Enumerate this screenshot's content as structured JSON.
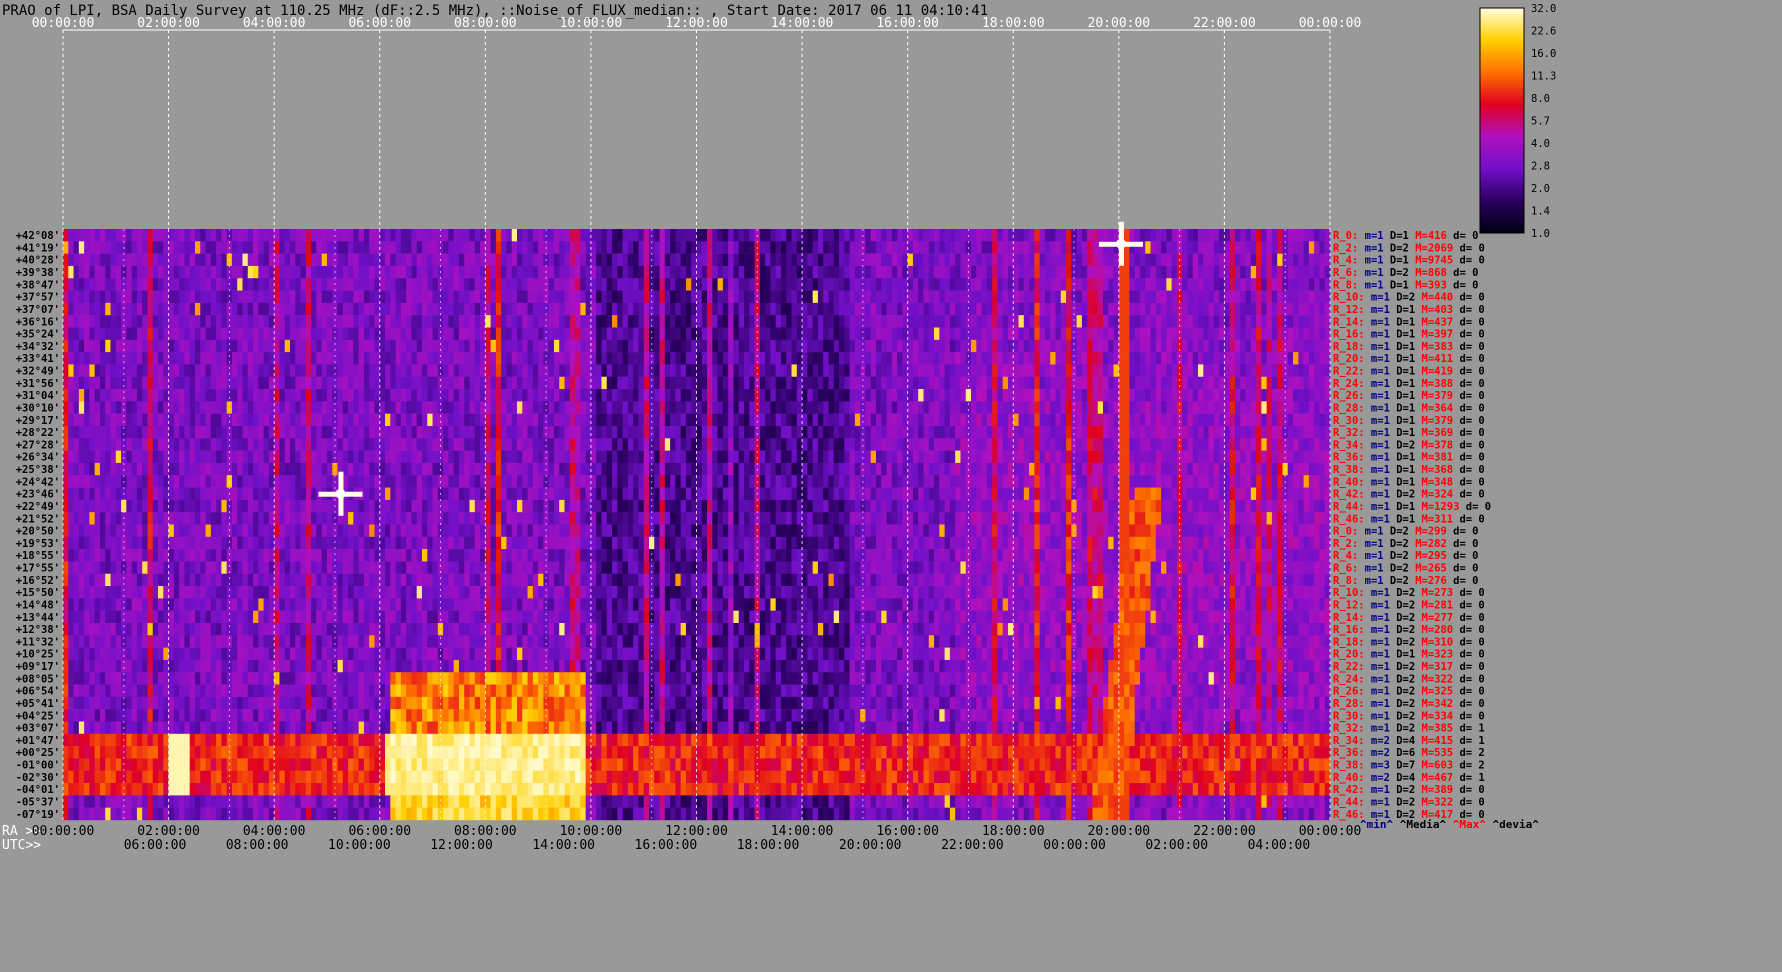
{
  "chart_data": {
    "type": "heatmap",
    "title": "PRAO of LPI, BSA Daily Survey at 110.25 MHz (dF::2.5 MHz), ::Noise_of_FLUX_median:: , Start Date: 2017 06 11 04:10:41",
    "top_time_ticks": [
      "00:00:00",
      "02:00:00",
      "04:00:00",
      "06:00:00",
      "08:00:00",
      "10:00:00",
      "12:00:00",
      "14:00:00",
      "16:00:00",
      "18:00:00",
      "20:00:00",
      "22:00:00",
      "00:00:00"
    ],
    "ra_label": "RA >>",
    "ra_ticks": [
      "00:00:00",
      "02:00:00",
      "04:00:00",
      "06:00:00",
      "08:00:00",
      "10:00:00",
      "12:00:00",
      "14:00:00",
      "16:00:00",
      "18:00:00",
      "20:00:00",
      "22:00:00",
      "00:00:00"
    ],
    "utc_label": "UTC>>",
    "utc_ticks": [
      "06:00:00",
      "08:00:00",
      "10:00:00",
      "12:00:00",
      "14:00:00",
      "16:00:00",
      "18:00:00",
      "20:00:00",
      "22:00:00",
      "00:00:00",
      "02:00:00",
      "04:00:00"
    ],
    "declinations": [
      "+42°08'",
      "+41°19'",
      "+40°28'",
      "+39°38'",
      "+38°47'",
      "+37°57'",
      "+37°07'",
      "+36°16'",
      "+35°24'",
      "+34°32'",
      "+33°41'",
      "+32°49'",
      "+31°56'",
      "+31°04'",
      "+30°10'",
      "+29°17'",
      "+28°22'",
      "+27°28'",
      "+26°34'",
      "+25°38'",
      "+24°42'",
      "+23°46'",
      "+22°49'",
      "+21°52'",
      "+20°50'",
      "+19°53'",
      "+18°55'",
      "+17°55'",
      "+16°52'",
      "+15°50'",
      "+14°48'",
      "+13°44'",
      "+12°38'",
      "+11°32'",
      "+10°25'",
      "+09°17'",
      "+08°05'",
      "+06°54'",
      "+05°41'",
      "+04°25'",
      "+03°07'",
      "+01°47'",
      "+00°25'",
      "-01°00'",
      "-02°30'",
      "-04°01'",
      "-05°37'",
      "-07°19'"
    ],
    "row_stats": [
      {
        "r": "R_0:",
        "m": "m=1",
        "d": "D=1",
        "M": "M=416",
        "dv": "d= 0"
      },
      {
        "r": "R_2:",
        "m": "m=1",
        "d": "D=2",
        "M": "M=2069",
        "dv": "d= 0"
      },
      {
        "r": "R_4:",
        "m": "m=1",
        "d": "D=1",
        "M": "M=9745",
        "dv": "d= 0"
      },
      {
        "r": "R_6:",
        "m": "m=1",
        "d": "D=2",
        "M": "M=868",
        "dv": "d= 0"
      },
      {
        "r": "R_8:",
        "m": "m=1",
        "d": "D=1",
        "M": "M=393",
        "dv": "d= 0"
      },
      {
        "r": "R_10:",
        "m": "m=1",
        "d": "D=2",
        "M": "M=440",
        "dv": "d= 0"
      },
      {
        "r": "R_12:",
        "m": "m=1",
        "d": "D=1",
        "M": "M=403",
        "dv": "d= 0"
      },
      {
        "r": "R_14:",
        "m": "m=1",
        "d": "D=1",
        "M": "M=437",
        "dv": "d= 0"
      },
      {
        "r": "R_16:",
        "m": "m=1",
        "d": "D=1",
        "M": "M=397",
        "dv": "d= 0"
      },
      {
        "r": "R_18:",
        "m": "m=1",
        "d": "D=1",
        "M": "M=383",
        "dv": "d= 0"
      },
      {
        "r": "R_20:",
        "m": "m=1",
        "d": "D=1",
        "M": "M=411",
        "dv": "d= 0"
      },
      {
        "r": "R_22:",
        "m": "m=1",
        "d": "D=1",
        "M": "M=419",
        "dv": "d= 0"
      },
      {
        "r": "R_24:",
        "m": "m=1",
        "d": "D=1",
        "M": "M=388",
        "dv": "d= 0"
      },
      {
        "r": "R_26:",
        "m": "m=1",
        "d": "D=1",
        "M": "M=379",
        "dv": "d= 0"
      },
      {
        "r": "R_28:",
        "m": "m=1",
        "d": "D=1",
        "M": "M=364",
        "dv": "d= 0"
      },
      {
        "r": "R_30:",
        "m": "m=1",
        "d": "D=1",
        "M": "M=379",
        "dv": "d= 0"
      },
      {
        "r": "R_32:",
        "m": "m=1",
        "d": "D=1",
        "M": "M=369",
        "dv": "d= 0"
      },
      {
        "r": "R_34:",
        "m": "m=1",
        "d": "D=2",
        "M": "M=378",
        "dv": "d= 0"
      },
      {
        "r": "R_36:",
        "m": "m=1",
        "d": "D=1",
        "M": "M=381",
        "dv": "d= 0"
      },
      {
        "r": "R_38:",
        "m": "m=1",
        "d": "D=1",
        "M": "M=368",
        "dv": "d= 0"
      },
      {
        "r": "R_40:",
        "m": "m=1",
        "d": "D=1",
        "M": "M=348",
        "dv": "d= 0"
      },
      {
        "r": "R_42:",
        "m": "m=1",
        "d": "D=2",
        "M": "M=324",
        "dv": "d= 0"
      },
      {
        "r": "R_44:",
        "m": "m=1",
        "d": "D=1",
        "M": "M=1293",
        "dv": "d= 0"
      },
      {
        "r": "R_46:",
        "m": "m=1",
        "d": "D=1",
        "M": "M=311",
        "dv": "d= 0"
      },
      {
        "r": "R_0:",
        "m": "m=1",
        "d": "D=2",
        "M": "M=299",
        "dv": "d= 0"
      },
      {
        "r": "R_2:",
        "m": "m=1",
        "d": "D=2",
        "M": "M=282",
        "dv": "d= 0"
      },
      {
        "r": "R_4:",
        "m": "m=1",
        "d": "D=2",
        "M": "M=295",
        "dv": "d= 0"
      },
      {
        "r": "R_6:",
        "m": "m=1",
        "d": "D=2",
        "M": "M=265",
        "dv": "d= 0"
      },
      {
        "r": "R_8:",
        "m": "m=1",
        "d": "D=2",
        "M": "M=276",
        "dv": "d= 0"
      },
      {
        "r": "R_10:",
        "m": "m=1",
        "d": "D=2",
        "M": "M=273",
        "dv": "d= 0"
      },
      {
        "r": "R_12:",
        "m": "m=1",
        "d": "D=2",
        "M": "M=281",
        "dv": "d= 0"
      },
      {
        "r": "R_14:",
        "m": "m=1",
        "d": "D=2",
        "M": "M=277",
        "dv": "d= 0"
      },
      {
        "r": "R_16:",
        "m": "m=1",
        "d": "D=2",
        "M": "M=280",
        "dv": "d= 0"
      },
      {
        "r": "R_18:",
        "m": "m=1",
        "d": "D=2",
        "M": "M=310",
        "dv": "d= 0"
      },
      {
        "r": "R_20:",
        "m": "m=1",
        "d": "D=1",
        "M": "M=323",
        "dv": "d= 0"
      },
      {
        "r": "R_22:",
        "m": "m=1",
        "d": "D=2",
        "M": "M=317",
        "dv": "d= 0"
      },
      {
        "r": "R_24:",
        "m": "m=1",
        "d": "D=2",
        "M": "M=322",
        "dv": "d= 0"
      },
      {
        "r": "R_26:",
        "m": "m=1",
        "d": "D=2",
        "M": "M=325",
        "dv": "d= 0"
      },
      {
        "r": "R_28:",
        "m": "m=1",
        "d": "D=2",
        "M": "M=342",
        "dv": "d= 0"
      },
      {
        "r": "R_30:",
        "m": "m=1",
        "d": "D=2",
        "M": "M=334",
        "dv": "d= 0"
      },
      {
        "r": "R_32:",
        "m": "m=1",
        "d": "D=2",
        "M": "M=385",
        "dv": "d= 1"
      },
      {
        "r": "R_34:",
        "m": "m=2",
        "d": "D=4",
        "M": "M=415",
        "dv": "d= 1"
      },
      {
        "r": "R_36:",
        "m": "m=2",
        "d": "D=6",
        "M": "M=535",
        "dv": "d= 2"
      },
      {
        "r": "R_38:",
        "m": "m=3",
        "d": "D=7",
        "M": "M=603",
        "dv": "d= 2"
      },
      {
        "r": "R_40:",
        "m": "m=2",
        "d": "D=4",
        "M": "M=467",
        "dv": "d= 1"
      },
      {
        "r": "R_42:",
        "m": "m=1",
        "d": "D=2",
        "M": "M=389",
        "dv": "d= 0"
      },
      {
        "r": "R_44:",
        "m": "m=1",
        "d": "D=2",
        "M": "M=322",
        "dv": "d= 0"
      },
      {
        "r": "R_46:",
        "m": "m=1",
        "d": "D=2",
        "M": "M=417",
        "dv": "d= 0"
      }
    ],
    "stats_legend": {
      "min": "^min^",
      "median": "^Media^",
      "max": "^Max^",
      "dev": "^devia^"
    },
    "colorbar": {
      "ticks": [
        "32.0",
        "22.6",
        "16.0",
        "11.3",
        "8.0",
        "5.7",
        "4.0",
        "2.8",
        "2.0",
        "1.4",
        "1.0"
      ],
      "stops": [
        "#000010",
        "#2a0060",
        "#7010c8",
        "#b010c0",
        "#e00020",
        "#ff7000",
        "#ffd000",
        "#ffffe0"
      ]
    },
    "colors": {
      "background": "#999999",
      "title": "#000000",
      "tick_text": "#ffffff",
      "stats_label": "#ff0000",
      "stats_text": "#000080",
      "grid": "#ffffff"
    }
  }
}
